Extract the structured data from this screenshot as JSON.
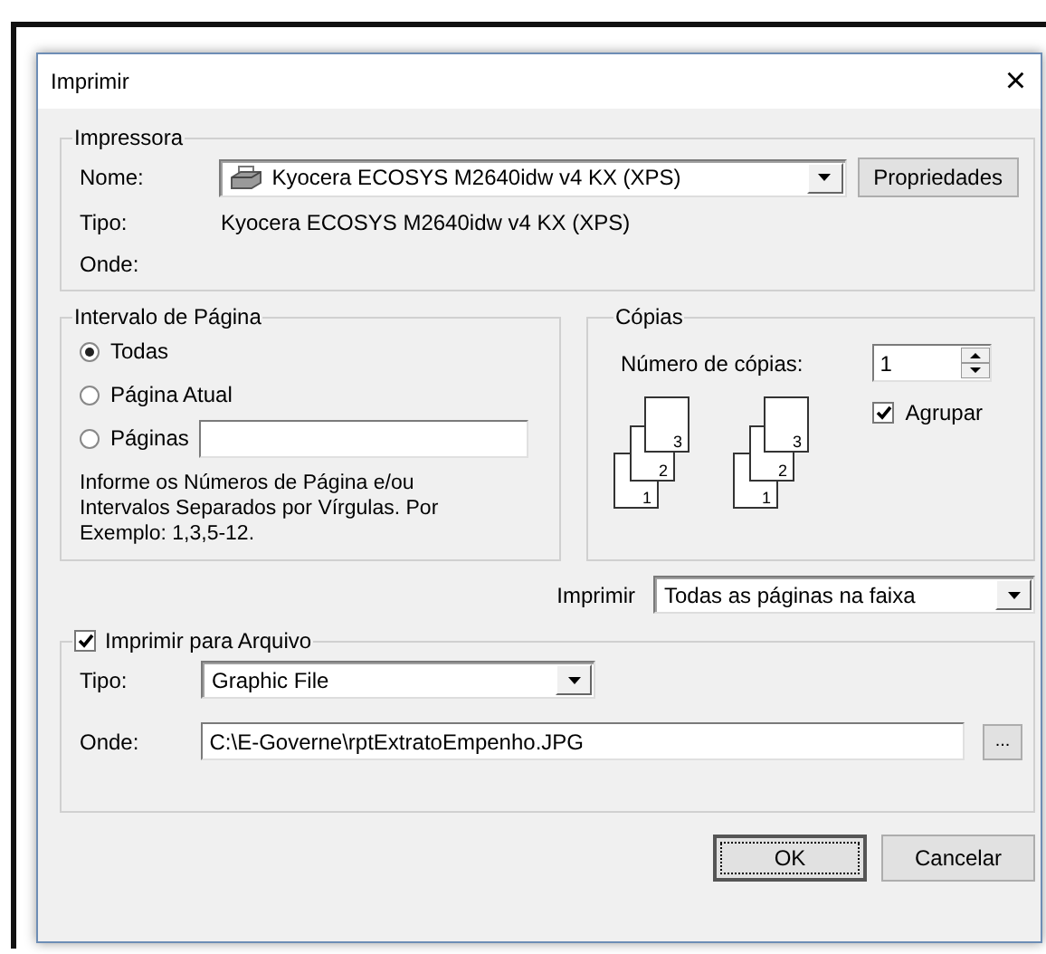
{
  "window": {
    "title": "Imprimir",
    "close": "×"
  },
  "printer": {
    "legend": "Impressora",
    "name_label": "Nome:",
    "name_value": "Kyocera ECOSYS M2640idw v4 KX (XPS)",
    "properties_button": "Propriedades",
    "type_label": "Tipo:",
    "type_value": "Kyocera ECOSYS M2640idw v4 KX (XPS)",
    "where_label": "Onde:"
  },
  "page_range": {
    "legend": "Intervalo de Página",
    "options": [
      {
        "label": "Todas",
        "selected": true,
        "kind": "plain"
      },
      {
        "label": "Página Atual",
        "selected": false,
        "kind": "plain"
      },
      {
        "label": "Páginas",
        "selected": false,
        "kind": "field"
      }
    ],
    "hint": "Informe os Números de Página e/ou Intervalos Separados por Vírgulas. Por Exemplo: 1,3,5-12."
  },
  "copies": {
    "legend": "Cópias",
    "count_label": "Número de cópias:",
    "count_value": "1",
    "collate_sets": [
      [
        "1",
        "2",
        "3"
      ],
      [
        "1",
        "2",
        "3"
      ]
    ],
    "collate": {
      "label": "Agrupar",
      "checked": true
    }
  },
  "print_what": {
    "label": "Imprimir",
    "value": "Todas as páginas na faixa"
  },
  "print_to_file": {
    "label": "Imprimir para Arquivo",
    "checked": true,
    "type_label": "Tipo:",
    "type_value": "Graphic File",
    "where_label": "Onde:",
    "where_value": "C:\\E-Governe\\rptExtratoEmpenho.JPG",
    "browse_button": "..."
  },
  "buttons": [
    {
      "label": "OK",
      "focused": true
    },
    {
      "label": "Cancelar",
      "focused": false
    }
  ]
}
